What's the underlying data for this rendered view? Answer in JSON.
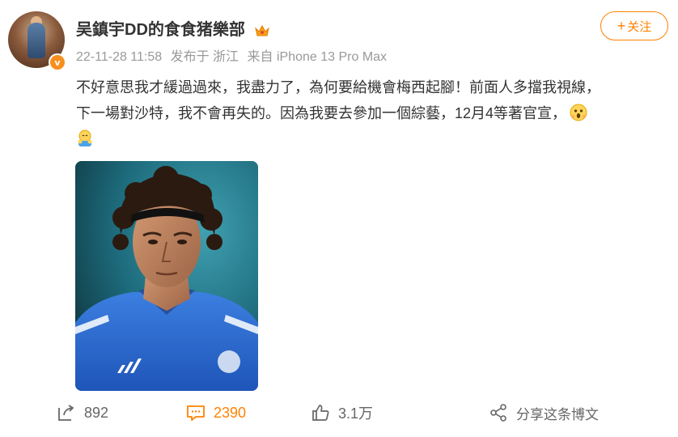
{
  "user": {
    "name": "吴鎮宇DD的食食猪樂部",
    "verified_badge": "v"
  },
  "meta": {
    "time": "22-11-28 11:58",
    "location": "发布于 浙江",
    "source": "来自 iPhone 13 Pro Max"
  },
  "follow_button": {
    "icon": "+",
    "label": "关注"
  },
  "post": {
    "line1": "不好意思我才緩過過來，我盡力了，為何要給機會梅西起腳！前面人多擋我視線，",
    "line2": "下一場對沙特，我不會再失的。因為我要去參加一個綜藝，12月4等著官宣，"
  },
  "actions": {
    "reposts": "892",
    "comments": "2390",
    "likes": "3.1万",
    "share_label": "分享这条博文"
  },
  "colors": {
    "accent": "#ff8200",
    "text": "#333333",
    "meta": "#999999"
  }
}
